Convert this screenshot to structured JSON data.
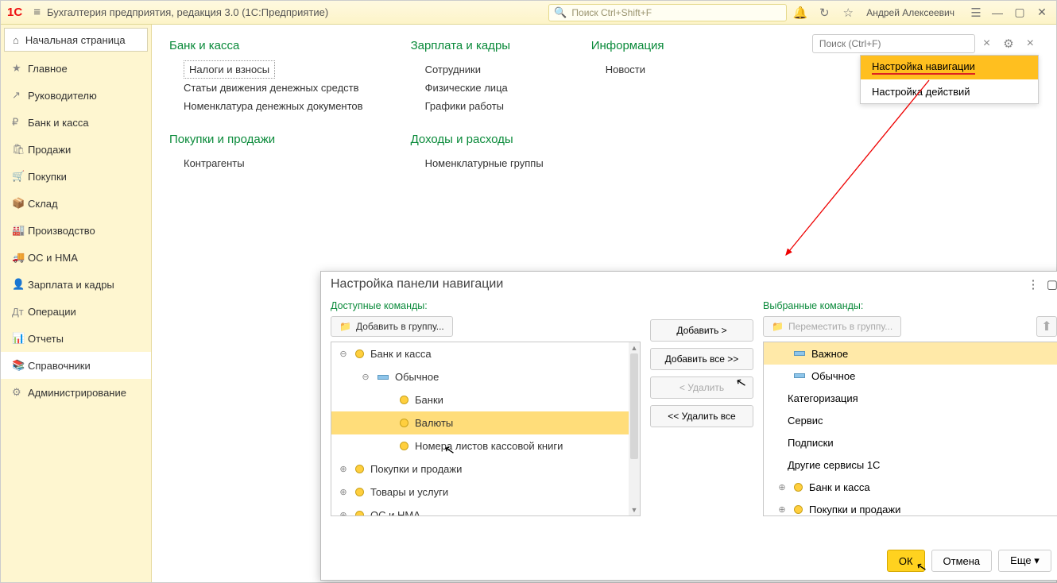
{
  "topbar": {
    "logo": "1С",
    "title": "Бухгалтерия предприятия, редакция 3.0  (1С:Предприятие)",
    "search_placeholder": "Поиск Ctrl+Shift+F",
    "user": "Андрей Алексеевич"
  },
  "sidebar": {
    "home": "Начальная страница",
    "items": [
      {
        "icon": "★",
        "label": "Главное"
      },
      {
        "icon": "↗",
        "label": "Руководителю"
      },
      {
        "icon": "₽",
        "label": "Банк и касса"
      },
      {
        "icon": "🛍",
        "label": "Продажи"
      },
      {
        "icon": "🛒",
        "label": "Покупки"
      },
      {
        "icon": "📦",
        "label": "Склад"
      },
      {
        "icon": "🏭",
        "label": "Производство"
      },
      {
        "icon": "🚚",
        "label": "ОС и НМА"
      },
      {
        "icon": "👤",
        "label": "Зарплата и кадры"
      },
      {
        "icon": "Дт",
        "label": "Операции"
      },
      {
        "icon": "📊",
        "label": "Отчеты"
      },
      {
        "icon": "📚",
        "label": "Справочники"
      },
      {
        "icon": "⚙",
        "label": "Администрирование"
      }
    ]
  },
  "panel_search": {
    "placeholder": "Поиск (Ctrl+F)"
  },
  "popup": {
    "nav": "Настройка навигации",
    "act": "Настройка действий"
  },
  "main": {
    "c1": {
      "head": "Банк и касса",
      "links": [
        "Налоги и взносы",
        "Статьи движения денежных средств",
        "Номенклатура денежных документов"
      ],
      "head2": "Покупки и продажи",
      "links2": [
        "Контрагенты"
      ]
    },
    "c2": {
      "head": "Зарплата и кадры",
      "links": [
        "Сотрудники",
        "Физические лица",
        "Графики работы"
      ],
      "head2": "Доходы и расходы",
      "links2": [
        "Номенклатурные группы"
      ]
    },
    "c3": {
      "head": "Информация",
      "links": [
        "Новости"
      ]
    }
  },
  "dialog": {
    "title": "Настройка панели навигации",
    "left_label": "Доступные команды:",
    "right_label": "Выбранные команды:",
    "add_group": "Добавить в группу...",
    "move_group": "Переместить в группу...",
    "left_tree": [
      {
        "exp": "⊖",
        "bullet": "y",
        "label": "Банк и касса",
        "ind": 0
      },
      {
        "exp": "⊖",
        "bullet": "b",
        "label": "Обычное",
        "ind": 1
      },
      {
        "exp": "",
        "bullet": "y",
        "label": "Банки",
        "ind": 2
      },
      {
        "exp": "",
        "bullet": "y",
        "label": "Валюты",
        "ind": 2,
        "sel": true
      },
      {
        "exp": "",
        "bullet": "y",
        "label": "Номера листов кассовой книги",
        "ind": 2
      },
      {
        "exp": "⊕",
        "bullet": "y",
        "label": "Покупки и продажи",
        "ind": 0
      },
      {
        "exp": "⊕",
        "bullet": "y",
        "label": "Товары и услуги",
        "ind": 0
      },
      {
        "exp": "⊕",
        "bullet": "y",
        "label": "ОС и НМА",
        "ind": 0
      }
    ],
    "mid": {
      "add": "Добавить >",
      "add_all": "Добавить все >>",
      "del": "< Удалить",
      "del_all": "<< Удалить все"
    },
    "right_tree": [
      {
        "bullet": "b",
        "label": "Важное",
        "sel": true
      },
      {
        "bullet": "b",
        "label": "Обычное"
      },
      {
        "bullet": "",
        "label": "Категоризация"
      },
      {
        "bullet": "",
        "label": "Сервис"
      },
      {
        "bullet": "",
        "label": "Подписки"
      },
      {
        "bullet": "",
        "label": "Другие сервисы 1С"
      },
      {
        "exp": "⊕",
        "bullet": "y",
        "label": "Банк и касса"
      },
      {
        "exp": "⊕",
        "bullet": "y",
        "label": "Покупки и продажи"
      }
    ],
    "footer": {
      "ok": "ОК",
      "cancel": "Отмена",
      "more": "Еще",
      "help": "?"
    }
  }
}
